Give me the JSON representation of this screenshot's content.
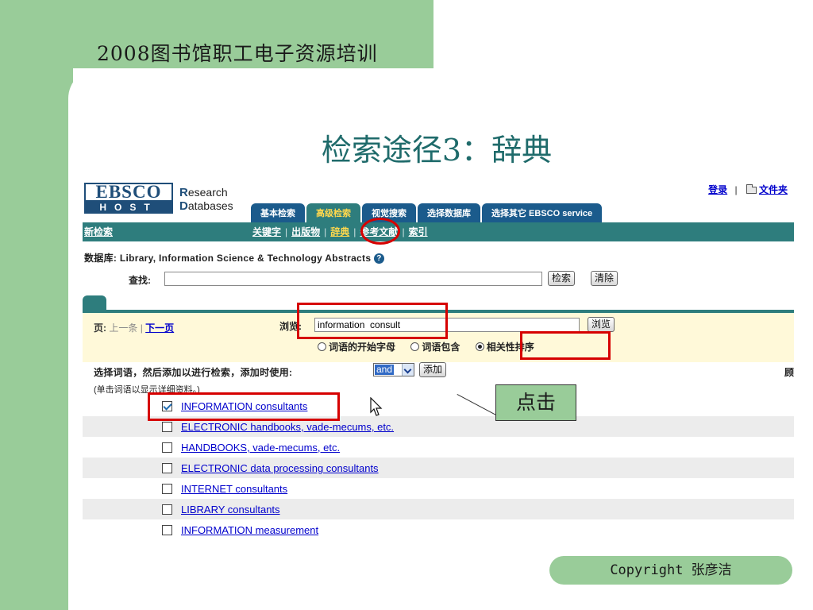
{
  "slide": {
    "header": "2008图书馆职工电子资源培训",
    "title": "检索途径3：辞典",
    "copyright": "Copyright  张彦洁",
    "callout": "点击"
  },
  "logo": {
    "ebsco": "EBSCO",
    "host": "HOST",
    "research": "Research",
    "databases": "Databases"
  },
  "top_links": {
    "login": "登录",
    "separator": "|",
    "folder": "文件夹"
  },
  "tabs": [
    {
      "label": "基本检索",
      "active": false
    },
    {
      "label": "高级检索",
      "active": true
    },
    {
      "label": "视觉搜索",
      "active": false
    },
    {
      "label": "选择数据库",
      "active": false
    },
    {
      "label": "选择其它 EBSCO service",
      "active": false
    }
  ],
  "nav": {
    "new_search": "新检索",
    "links": [
      "关键字",
      "出版物",
      "辞典",
      "参考文献",
      "索引"
    ],
    "separator": "|"
  },
  "database": {
    "label": "数据库: Library, Information Science & Technology Abstracts",
    "help_icon": "?"
  },
  "search": {
    "label": "查找:",
    "value": "",
    "search_button": "检索",
    "clear_button": "清除"
  },
  "browse": {
    "page_label": "页:",
    "prev": "上一条",
    "separator": "|",
    "next": "下一页",
    "label": "浏览:",
    "value": "information  consult",
    "button": "浏览",
    "options": [
      {
        "label": "词语的开始字母",
        "selected": false
      },
      {
        "label": "词语包含",
        "selected": false
      },
      {
        "label": "相关性排序",
        "selected": true
      }
    ]
  },
  "select_terms": {
    "instruction": "选择词语，然后添加以进行检索，添加时使用:",
    "operator": "and",
    "add_button": "添加",
    "cut_char": "顾",
    "hint": "(单击词语以显示详细资料。)"
  },
  "results": [
    {
      "term": "INFORMATION consultants",
      "checked": true
    },
    {
      "term": "ELECTRONIC handbooks, vade-mecums, etc.",
      "checked": false
    },
    {
      "term": "HANDBOOKS, vade-mecums, etc.",
      "checked": false
    },
    {
      "term": "ELECTRONIC data processing consultants",
      "checked": false
    },
    {
      "term": "INTERNET consultants",
      "checked": false
    },
    {
      "term": "LIBRARY consultants",
      "checked": false
    },
    {
      "term": "INFORMATION measurement",
      "checked": false
    }
  ],
  "colors": {
    "slide_green": "#99cc99",
    "title_teal": "#1f6b6b",
    "ebsco_teal": "#2e7d7d",
    "tab_blue": "#1b5b8c",
    "annotation_red": "#d60000",
    "link_blue": "#0000cc"
  },
  "icons": [
    "folder-icon",
    "help-icon",
    "chevron-down-icon",
    "checkbox-checked-icon",
    "mouse-cursor-icon"
  ]
}
